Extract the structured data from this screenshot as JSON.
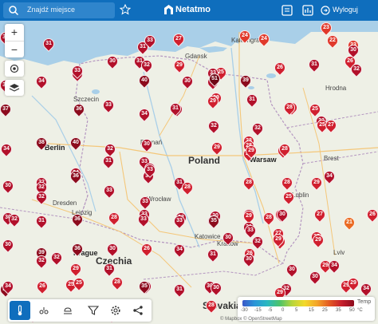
{
  "topbar": {
    "search_placeholder": "Znajdź miejsce",
    "logo_text": "Netatmo",
    "logout_label": "Wyloguj",
    "color": "#0f6ebd"
  },
  "map": {
    "country_label": "Poland",
    "cities": [
      {
        "name": "Gdansk",
        "style": "small"
      },
      {
        "name": "Kaliningrad",
        "style": "small"
      },
      {
        "name": "Szczecin",
        "style": "small"
      },
      {
        "name": "Berlin",
        "style": "big"
      },
      {
        "name": "Poznań",
        "style": "small"
      },
      {
        "name": "Warsaw",
        "style": "big"
      },
      {
        "name": "Hrodna",
        "style": "small"
      },
      {
        "name": "Brest",
        "style": "small"
      },
      {
        "name": "Lublin",
        "style": "small"
      },
      {
        "name": "Wrocław",
        "style": "small"
      },
      {
        "name": "Dresden",
        "style": "small"
      },
      {
        "name": "Leipzig",
        "style": "small"
      },
      {
        "name": "Katowice",
        "style": "small"
      },
      {
        "name": "Krakow",
        "style": "small"
      },
      {
        "name": "Prague",
        "style": "big"
      },
      {
        "name": "Czechia",
        "style": "country"
      },
      {
        "name": "Lviv",
        "style": "small"
      },
      {
        "name": "Slovakia",
        "style": "country"
      },
      {
        "name": "Brno",
        "style": "small"
      }
    ],
    "markers": [
      {
        "v": "23"
      },
      {
        "v": "31"
      },
      {
        "v": "33"
      },
      {
        "v": "31"
      },
      {
        "v": "22"
      },
      {
        "v": "27"
      },
      {
        "v": "24"
      },
      {
        "v": "23"
      },
      {
        "v": "26"
      },
      {
        "v": "31"
      },
      {
        "v": "31"
      },
      {
        "v": "32"
      },
      {
        "v": "26"
      },
      {
        "v": "31"
      },
      {
        "v": "33"
      },
      {
        "v": "30"
      },
      {
        "v": "29"
      },
      {
        "v": "25"
      },
      {
        "v": "30"
      },
      {
        "v": "33"
      },
      {
        "v": "32"
      },
      {
        "v": "30"
      },
      {
        "v": "33"
      },
      {
        "v": "34"
      },
      {
        "v": "40"
      },
      {
        "v": "30"
      },
      {
        "v": "51"
      },
      {
        "v": "39"
      },
      {
        "v": "24"
      },
      {
        "v": "32"
      },
      {
        "v": "31"
      },
      {
        "v": "29"
      },
      {
        "v": "31"
      },
      {
        "v": "29"
      },
      {
        "v": "25"
      },
      {
        "v": "26"
      },
      {
        "v": "37"
      },
      {
        "v": "36"
      },
      {
        "v": "31"
      },
      {
        "v": "34"
      },
      {
        "v": "32"
      },
      {
        "v": "33"
      },
      {
        "v": "30"
      },
      {
        "v": "25"
      },
      {
        "v": "27"
      },
      {
        "v": "33"
      },
      {
        "v": "38"
      },
      {
        "v": "40"
      },
      {
        "v": "32"
      },
      {
        "v": "30"
      },
      {
        "v": "28"
      },
      {
        "v": "29"
      },
      {
        "v": "26"
      },
      {
        "v": "28"
      },
      {
        "v": "28"
      },
      {
        "v": "32"
      },
      {
        "v": "27"
      },
      {
        "v": "34"
      },
      {
        "v": "31"
      },
      {
        "v": "33"
      },
      {
        "v": "32"
      },
      {
        "v": "29"
      },
      {
        "v": "28"
      },
      {
        "v": "34"
      },
      {
        "v": "32"
      },
      {
        "v": "36"
      },
      {
        "v": "30"
      },
      {
        "v": "28"
      },
      {
        "v": "33"
      },
      {
        "v": "28"
      },
      {
        "v": "34"
      },
      {
        "v": "29"
      },
      {
        "v": "30"
      },
      {
        "v": "32"
      },
      {
        "v": "33"
      },
      {
        "v": "31"
      },
      {
        "v": "25"
      },
      {
        "v": "27"
      },
      {
        "v": "31"
      },
      {
        "v": "33"
      },
      {
        "v": "28"
      },
      {
        "v": "32"
      },
      {
        "v": "36"
      },
      {
        "v": "28"
      },
      {
        "v": "33"
      },
      {
        "v": "32"
      },
      {
        "v": "29"
      },
      {
        "v": "30"
      },
      {
        "v": "31"
      },
      {
        "v": "30"
      },
      {
        "v": "32"
      },
      {
        "v": "33"
      },
      {
        "v": "28"
      },
      {
        "v": "30"
      },
      {
        "v": "27"
      },
      {
        "v": "26"
      },
      {
        "v": "27"
      },
      {
        "v": "31"
      },
      {
        "v": "21"
      },
      {
        "v": "29"
      },
      {
        "v": "27"
      },
      {
        "v": "33"
      },
      {
        "v": "31"
      },
      {
        "v": "33"
      },
      {
        "v": "35"
      },
      {
        "v": "32"
      },
      {
        "v": "30"
      },
      {
        "v": "26"
      },
      {
        "v": "39"
      },
      {
        "v": "36"
      },
      {
        "v": "32"
      },
      {
        "v": "30"
      },
      {
        "v": "29"
      },
      {
        "v": "30"
      },
      {
        "v": "32"
      },
      {
        "v": "26"
      },
      {
        "v": "34"
      },
      {
        "v": "31"
      },
      {
        "v": "30"
      },
      {
        "v": "28"
      },
      {
        "v": "29"
      },
      {
        "v": "29"
      },
      {
        "v": "30"
      },
      {
        "v": "30"
      },
      {
        "v": "36"
      },
      {
        "v": "34"
      },
      {
        "v": "25"
      },
      {
        "v": "31"
      },
      {
        "v": "28"
      },
      {
        "v": "29"
      },
      {
        "v": "30"
      },
      {
        "v": "33"
      },
      {
        "v": "32"
      },
      {
        "v": "34"
      },
      {
        "v": "26"
      },
      {
        "v": "25"
      },
      {
        "v": "31"
      },
      {
        "v": "35"
      },
      {
        "v": "28"
      },
      {
        "v": "30"
      },
      {
        "v": "32"
      },
      {
        "v": "29"
      },
      {
        "v": "34"
      },
      {
        "v": "35"
      },
      {
        "v": "29"
      }
    ]
  },
  "legend": {
    "title": "Temp",
    "unit": "°C",
    "ticks": [
      "-30",
      "-15",
      "-5",
      "0",
      "5",
      "15",
      "25",
      "35",
      "50"
    ]
  },
  "attribution": "© Mapbox © OpenStreetMap"
}
